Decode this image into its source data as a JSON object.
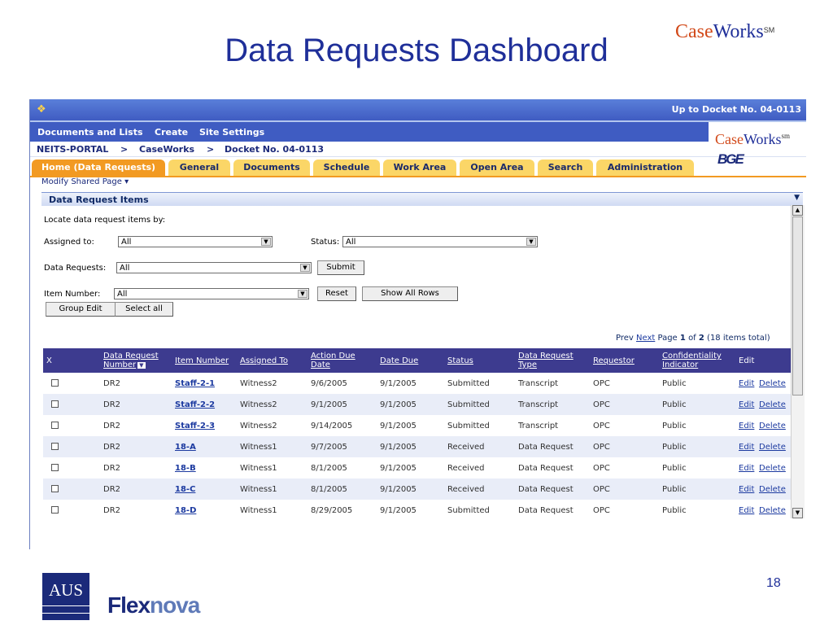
{
  "slide": {
    "title": "Data Requests Dashboard",
    "logo_case": "Case",
    "logo_works": "Works",
    "logo_sm": "SM",
    "page_number": "18",
    "aus_logo": "AUS",
    "flexnova_part1": "Flex",
    "flexnova_part2": "nova"
  },
  "app": {
    "topbar": {
      "docket_link": "Up to Docket No. 04-0113"
    },
    "menu": {
      "documents_and_lists": "Documents and Lists",
      "create": "Create",
      "site_settings": "Site Settings"
    },
    "breadcrumb": {
      "portal": "NEITS-PORTAL",
      "sep1": ">",
      "caseworks": "CaseWorks",
      "sep2": ">",
      "docket": "Docket No. 04-0113"
    },
    "logo": {
      "case": "Case",
      "works": "Works",
      "sm": "sm",
      "bge": "BGE"
    },
    "tabs": [
      "Home (Data Requests)",
      "General",
      "Documents",
      "Schedule",
      "Work Area",
      "Open Area",
      "Search",
      "Administration"
    ],
    "modify_shared_page": "Modify Shared Page ▾",
    "webpart": {
      "title": "Data Request Items",
      "menu_icon": "▼",
      "locate_label": "Locate data request items by:"
    },
    "filters": {
      "assigned_to_label": "Assigned to:",
      "assigned_to_value": "All",
      "status_label": "Status:",
      "status_value": "All",
      "data_requests_label": "Data Requests:",
      "data_requests_value": "All",
      "item_number_label": "Item Number:",
      "item_number_value": "All",
      "submit": "Submit",
      "reset": "Reset",
      "show_all_rows": "Show All Rows",
      "group_edit": "Group Edit",
      "select_all": "Select all"
    },
    "pager": {
      "prev": "Prev",
      "next": "Next",
      "page_word": "Page",
      "current": "1",
      "of": "of",
      "total_pages": "2",
      "items_total": "(18 items total)"
    },
    "table": {
      "headers": {
        "x": "X",
        "dr1": "Data Request",
        "dr2": "Number",
        "item_number": "Item Number",
        "assigned_to": "Assigned To",
        "adu1": "Action Due",
        "adu2": "Date",
        "date_due": "Date Due",
        "status": "Status",
        "drt1": "Data Request",
        "drt2": "Type",
        "requestor": "Requestor",
        "ci1": "Confidentiality",
        "ci2": "Indicator",
        "edit": "Edit"
      },
      "rows": [
        {
          "dr": "DR2",
          "item": "Staff-2-1",
          "assigned": "Witness2",
          "action_due": "9/6/2005",
          "date_due": "9/1/2005",
          "status": "Submitted",
          "type": "Transcript",
          "requestor": "OPC",
          "conf": "Public",
          "edit": "Edit",
          "delete": "Delete"
        },
        {
          "dr": "DR2",
          "item": "Staff-2-2",
          "assigned": "Witness2",
          "action_due": "9/1/2005",
          "date_due": "9/1/2005",
          "status": "Submitted",
          "type": "Transcript",
          "requestor": "OPC",
          "conf": "Public",
          "edit": "Edit",
          "delete": "Delete"
        },
        {
          "dr": "DR2",
          "item": "Staff-2-3",
          "assigned": "Witness2",
          "action_due": "9/14/2005",
          "date_due": "9/1/2005",
          "status": "Submitted",
          "type": "Transcript",
          "requestor": "OPC",
          "conf": "Public",
          "edit": "Edit",
          "delete": "Delete"
        },
        {
          "dr": "DR2",
          "item": "18-A",
          "assigned": "Witness1",
          "action_due": "9/7/2005",
          "date_due": "9/1/2005",
          "status": "Received",
          "type": "Data Request",
          "requestor": "OPC",
          "conf": "Public",
          "edit": "Edit",
          "delete": "Delete"
        },
        {
          "dr": "DR2",
          "item": "18-B",
          "assigned": "Witness1",
          "action_due": "8/1/2005",
          "date_due": "9/1/2005",
          "status": "Received",
          "type": "Data Request",
          "requestor": "OPC",
          "conf": "Public",
          "edit": "Edit",
          "delete": "Delete"
        },
        {
          "dr": "DR2",
          "item": "18-C",
          "assigned": "Witness1",
          "action_due": "8/1/2005",
          "date_due": "9/1/2005",
          "status": "Received",
          "type": "Data Request",
          "requestor": "OPC",
          "conf": "Public",
          "edit": "Edit",
          "delete": "Delete"
        },
        {
          "dr": "DR2",
          "item": "18-D",
          "assigned": "Witness1",
          "action_due": "8/29/2005",
          "date_due": "9/1/2005",
          "status": "Submitted",
          "type": "Data Request",
          "requestor": "OPC",
          "conf": "Public",
          "edit": "Edit",
          "delete": "Delete"
        }
      ]
    }
  }
}
